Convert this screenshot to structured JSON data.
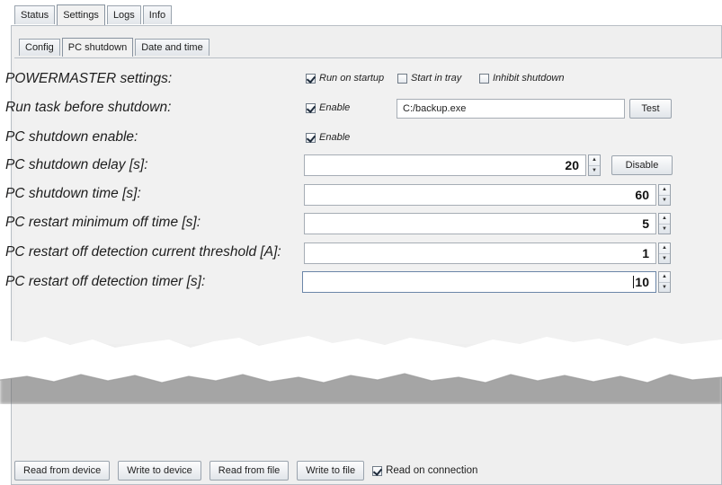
{
  "main_tabs": [
    {
      "label": "Status",
      "active": false
    },
    {
      "label": "Settings",
      "active": true
    },
    {
      "label": "Logs",
      "active": false
    },
    {
      "label": "Info",
      "active": false
    }
  ],
  "sub_tabs": [
    {
      "label": "Config",
      "active": false
    },
    {
      "label": "PC shutdown",
      "active": true
    },
    {
      "label": "Date and time",
      "active": false
    }
  ],
  "powermaster": {
    "label": "POWERMASTER settings:",
    "run_on_startup": {
      "label": "Run on startup",
      "checked": true
    },
    "start_in_tray": {
      "label": "Start in tray",
      "checked": false
    },
    "inhibit_shutdown": {
      "label": "Inhibit shutdown",
      "checked": false
    }
  },
  "run_task": {
    "label": "Run task before shutdown:",
    "enable": {
      "label": "Enable",
      "checked": true
    },
    "path": "C:/backup.exe",
    "test_button": "Test"
  },
  "pc_shutdown_enable": {
    "label": "PC shutdown enable:",
    "enable": {
      "label": "Enable",
      "checked": true
    }
  },
  "shutdown_delay": {
    "label": "PC shutdown delay [s]:",
    "value": "20",
    "disable_button": "Disable"
  },
  "shutdown_time": {
    "label": "PC shutdown time [s]:",
    "value": "60"
  },
  "restart_min_off": {
    "label": "PC restart minimum off time [s]:",
    "value": "5"
  },
  "restart_threshold": {
    "label": "PC restart off detection current threshold [A]:",
    "value": "1"
  },
  "restart_timer": {
    "label": "PC restart off detection timer [s]:",
    "value": "10"
  },
  "bottom": {
    "read_from_device": "Read from device",
    "write_to_device": "Write to device",
    "read_from_file": "Read from file",
    "write_to_file": "Write to file",
    "read_on_connection": {
      "label": "Read on connection",
      "checked": true
    }
  }
}
